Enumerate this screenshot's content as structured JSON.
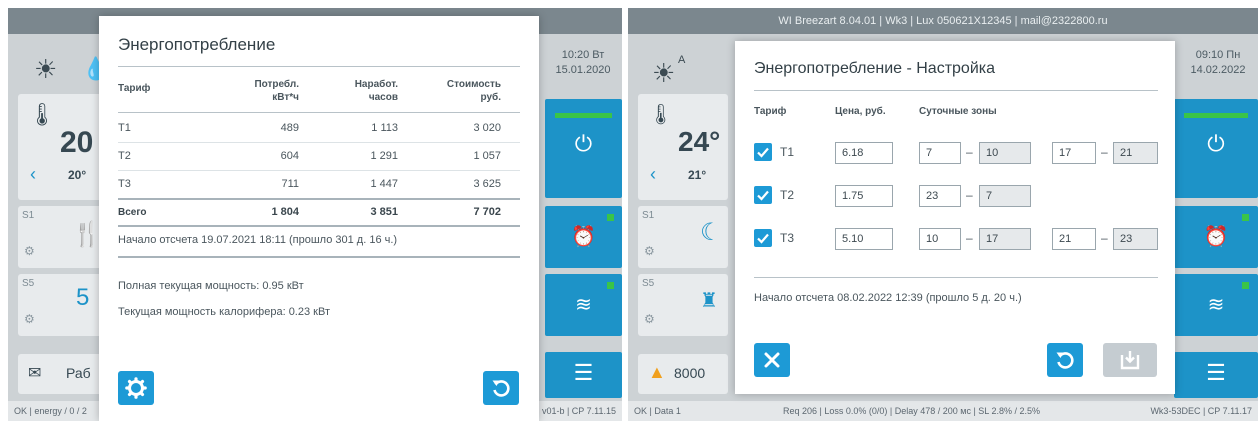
{
  "left": {
    "dialog": {
      "title": "Энергопотребление",
      "headers": {
        "tariff": "Тариф",
        "consumption": "Потребл.",
        "consumption_unit": "кВт*ч",
        "runtime": "Наработ.",
        "runtime_unit": "часов",
        "cost": "Стоимость",
        "cost_unit": "руб."
      },
      "rows": [
        {
          "tariff": "T1",
          "consumption": "489",
          "runtime": "1 113",
          "cost": "3 020"
        },
        {
          "tariff": "T2",
          "consumption": "604",
          "runtime": "1 291",
          "cost": "1 057"
        },
        {
          "tariff": "T3",
          "consumption": "711",
          "runtime": "1 447",
          "cost": "3 625"
        }
      ],
      "total": {
        "label": "Всего",
        "consumption": "1 804",
        "runtime": "3 851",
        "cost": "7 702"
      },
      "start_text": "Начало отсчета 19.07.2021 18:11 (прошло 301 д. 16 ч.)",
      "power_total": "Полная текущая мощность: 0.95 кВт",
      "power_heater": "Текущая мощность калорифера: 0.23 кВт",
      "settings_icon": "gear-icon",
      "reset_icon": "undo-icon"
    },
    "background": {
      "temp_big": "20",
      "temp_small": "20°",
      "s1_label": "S1",
      "s5_label": "S5",
      "s5_value": "5",
      "message_text": "Раб",
      "clock_time": "10:20 Вт",
      "clock_date": "15.01.2020"
    },
    "status_left": "OK | energy / 0 / 2",
    "status_right": "v01-b | CP 7.11.15"
  },
  "right": {
    "topbar_text": "WI Breezart 8.04.01 | Wk3 | Lux 050621X12345 | mail@2322800.ru",
    "dialog": {
      "title": "Энергопотребление - Настройка",
      "headers": {
        "tariff": "Тариф",
        "price": "Цена, руб.",
        "zones": "Суточные зоны"
      },
      "rows": [
        {
          "tariff": "T1",
          "price": "6.18",
          "z1_from": "7",
          "z1_to": "10",
          "z2_from": "17",
          "z2_to": "21"
        },
        {
          "tariff": "T2",
          "price": "1.75",
          "z1_from": "23",
          "z1_to": "7"
        },
        {
          "tariff": "T3",
          "price": "5.10",
          "z1_from": "10",
          "z1_to": "17",
          "z2_from": "21",
          "z2_to": "23"
        }
      ],
      "dash": "–",
      "start_text": "Начало отсчета 08.02.2022 12:39 (прошло 5 д. 20 ч.)",
      "close_icon": "close-icon",
      "reset_icon": "undo-icon",
      "save_icon": "save-icon"
    },
    "background": {
      "temp_big": "24°",
      "temp_small": "21°",
      "s1_label": "S1",
      "s5_label": "S5",
      "warning_text": "8000",
      "clock_time": "09:10 Пн",
      "clock_date": "14.02.2022"
    },
    "status_left": "OK | Data 1",
    "status_mid": "Req 206 | Loss 0.0% (0/0) | Delay 478 / 200 мс | SL 2.8% / 2.5%",
    "status_right": "Wk3-53DEC | CP 7.11.17"
  },
  "colors": {
    "accent": "#1d9ad6",
    "green": "#3ac448",
    "panel": "#cdd2d5"
  }
}
